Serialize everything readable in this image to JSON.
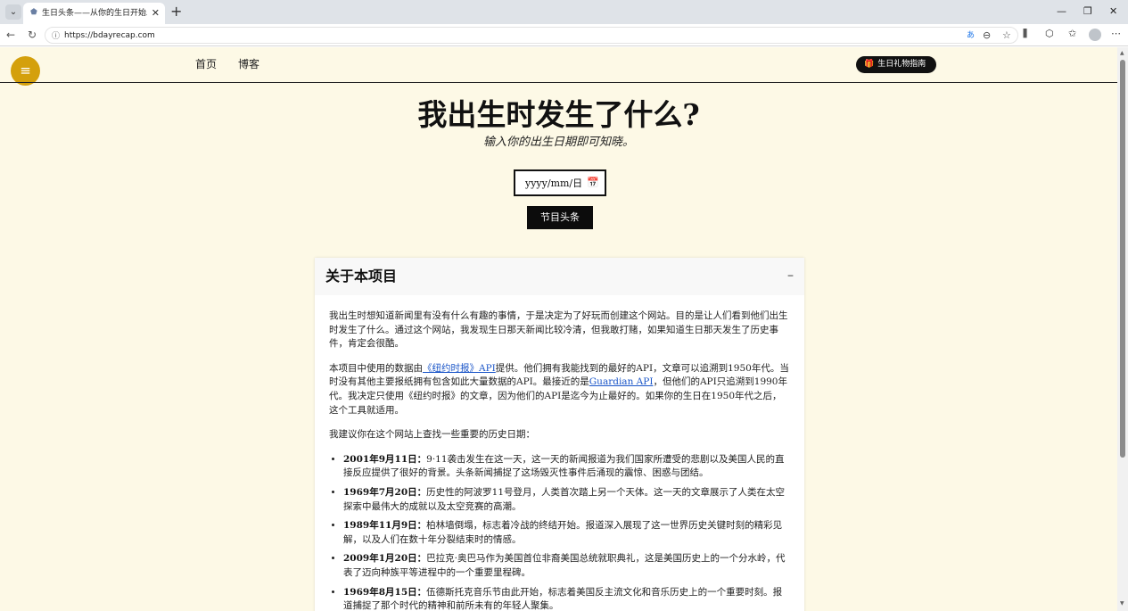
{
  "browser": {
    "tab_title": "生日头条——从你的生日开始发现",
    "url": "https://bdayrecap.com"
  },
  "nav": {
    "home": "首页",
    "blog": "博客",
    "gift_guide": "生日礼物指南"
  },
  "hero": {
    "title": "我出生时发生了什么?",
    "subtitle": "输入你的出生日期即可知晓。",
    "date_placeholder": "yyyy/mm/日",
    "submit_label": "节目头条"
  },
  "about": {
    "title": "关于本项目",
    "para1": "我出生时想知道新闻里有没有什么有趣的事情，于是决定为了好玩而创建这个网站。目的是让人们看到他们出生时发生了什么。通过这个网站，我发现生日那天新闻比较冷清，但我敢打赌，如果知道生日那天发生了历史事件，肯定会很酷。",
    "para2": {
      "pre": "本项目中使用的数据由",
      "nyt_link": "《纽约时报》API",
      "mid": "提供。他们拥有我能找到的最好的API，文章可以追溯到1950年代。当时没有其他主要报纸拥有包含如此大量数据的API。最接近的是",
      "guardian_link": "Guardian API",
      "post": "，但他们的API只追溯到1990年代。我决定只使用《纽约时报》的文章，因为他们的API是迄今为止最好的。如果你的生日在1950年代之后，这个工具就适用。"
    },
    "para3": "我建议你在这个网站上查找一些重要的历史日期：",
    "dates": [
      {
        "date": "2001年9月11日：",
        "text": "9·11袭击发生在这一天，这一天的新闻报道为我们国家所遭受的悲剧以及美国人民的直接反应提供了很好的背景。头条新闻捕捉了这场毁灭性事件后涌现的震惊、困惑与团结。"
      },
      {
        "date": "1969年7月20日：",
        "text": "历史性的阿波罗11号登月，人类首次踏上另一个天体。这一天的文章展示了人类在太空探索中最伟大的成就以及太空竞赛的高潮。"
      },
      {
        "date": "1989年11月9日：",
        "text": "柏林墙倒塌，标志着冷战的终结开始。报道深入展现了这一世界历史关键时刻的精彩见解，以及人们在数十年分裂结束时的情感。"
      },
      {
        "date": "2009年1月20日：",
        "text": "巴拉克·奥巴马作为美国首位非裔美国总统就职典礼，这是美国历史上的一个分水岭，代表了迈向种族平等进程中的一个重要里程碑。"
      },
      {
        "date": "1969年8月15日：",
        "text": "伍德斯托克音乐节由此开始，标志着美国反主流文化和音乐历史上的一个重要时刻。报道捕捉了那个时代的精神和前所未有的年轻人聚集。"
      }
    ]
  }
}
